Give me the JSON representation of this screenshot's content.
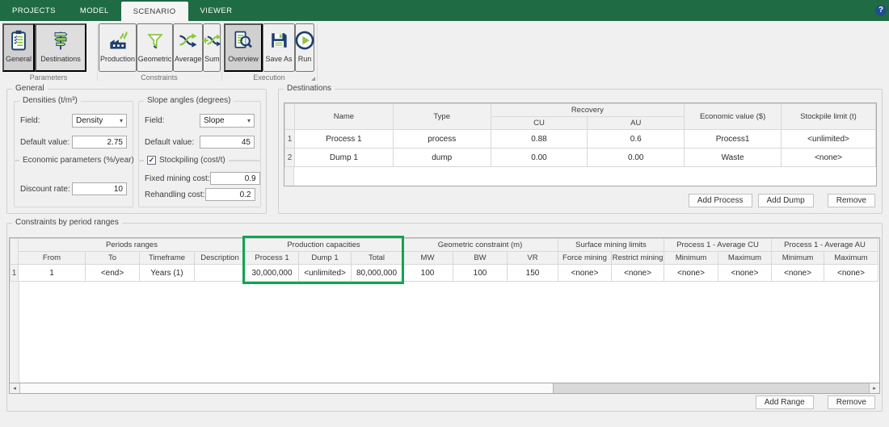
{
  "colors": {
    "ribbon_green": "#1f6b43",
    "icon_navy": "#1d3f6e",
    "icon_green": "#8dc63f",
    "highlight_green": "#12a452"
  },
  "tabbar": {
    "tabs": [
      {
        "label": "PROJECTS",
        "active": false
      },
      {
        "label": "MODEL",
        "active": false
      },
      {
        "label": "SCENARIO",
        "active": true
      },
      {
        "label": "VIEWER",
        "active": false
      }
    ],
    "help_label": "?"
  },
  "ribbon": {
    "groups": [
      {
        "label": "Parameters"
      },
      {
        "label": "Constraints"
      },
      {
        "label": "Execution"
      }
    ],
    "buttons": {
      "general": "General",
      "destinations": "Destinations",
      "production": "Production",
      "geometric": "Geometric",
      "average": "Average",
      "sum": "Sum",
      "overview": "Overview",
      "save_as": "Save As",
      "run": "Run"
    }
  },
  "general": {
    "title": "General",
    "densities": {
      "title": "Densities (t/m³)",
      "field_label": "Field:",
      "field_value": "Density",
      "default_label": "Default value:",
      "default_value": "2.75"
    },
    "slope": {
      "title": "Slope angles (degrees)",
      "field_label": "Field:",
      "field_value": "Slope",
      "default_label": "Default value:",
      "default_value": "45"
    },
    "economic": {
      "title": "Economic parameters (%/year)",
      "discount_label": "Discount rate:",
      "discount_value": "10"
    },
    "stockpiling": {
      "title": "Stockpiling (cost/t)",
      "checked": true,
      "fixed_label": "Fixed mining cost:",
      "fixed_value": "0.9",
      "rehandling_label": "Rehandling cost:",
      "rehandling_value": "0.2"
    }
  },
  "destinations": {
    "title": "Destinations",
    "columns": {
      "name": "Name",
      "type": "Type",
      "recovery": "Recovery",
      "cu": "CU",
      "au": "AU",
      "economic": "Economic value ($)",
      "stockpile": "Stockpile limit (t)"
    },
    "rows": [
      {
        "num": "1",
        "name": "Process 1",
        "type": "process",
        "cu": "0.88",
        "au": "0.6",
        "economic": "Process1",
        "stockpile": "<unlimited>"
      },
      {
        "num": "2",
        "name": "Dump 1",
        "type": "dump",
        "cu": "0.00",
        "au": "0.00",
        "economic": "Waste",
        "stockpile": "<none>"
      }
    ],
    "buttons": {
      "add_process": "Add Process",
      "add_dump": "Add Dump",
      "remove": "Remove"
    }
  },
  "constraints": {
    "title": "Constraints by period ranges",
    "header_groups": [
      {
        "label": "Periods ranges",
        "span": 4
      },
      {
        "label": "Production capacities",
        "span": 3,
        "highlighted": true
      },
      {
        "label": "Geometric constraint (m)",
        "span": 3
      },
      {
        "label": "Surface mining limits",
        "span": 2
      },
      {
        "label": "Process 1 - Average CU",
        "span": 2
      },
      {
        "label": "Process 1 - Average AU",
        "span": 2
      }
    ],
    "columns": [
      "From",
      "To",
      "Timeframe",
      "Description",
      "Process 1",
      "Dump 1",
      "Total",
      "MW",
      "BW",
      "VR",
      "Force mining",
      "Restrict mining",
      "Minimum",
      "Maximum",
      "Minimum",
      "Maximum"
    ],
    "row": {
      "num": "1",
      "values": [
        "1",
        "<end>",
        "Years (1)",
        "",
        "30,000,000",
        "<unlimited>",
        "80,000,000",
        "100",
        "100",
        "150",
        "<none>",
        "<none>",
        "<none>",
        "<none>",
        "<none>",
        "<none>"
      ]
    },
    "buttons": {
      "add_range": "Add Range",
      "remove": "Remove"
    }
  }
}
